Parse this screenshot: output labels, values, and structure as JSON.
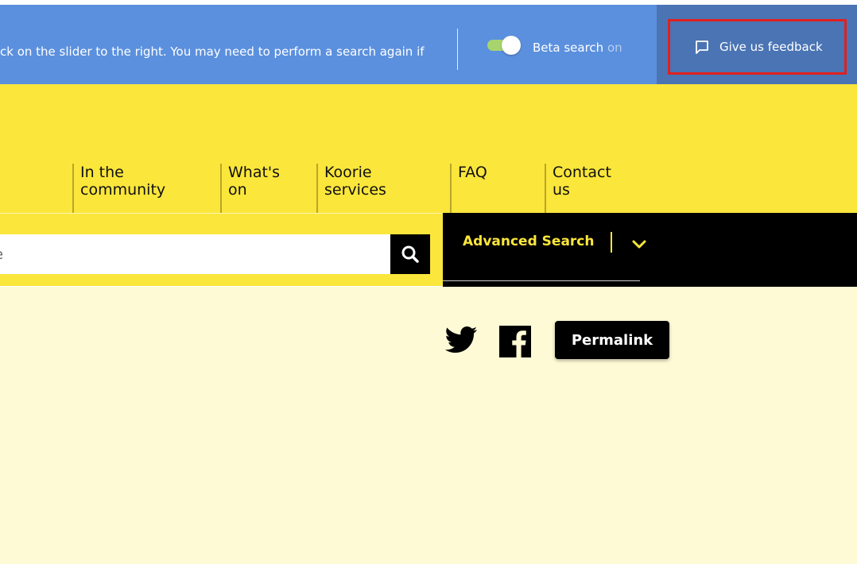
{
  "banner": {
    "message": "ck on the slider to the right. You may need to perform a search again if",
    "toggle_label": "Beta search",
    "toggle_state": "on",
    "feedback_label": "Give us feedback"
  },
  "nav": {
    "items": [
      {
        "line1": "In the",
        "line2": "community"
      },
      {
        "line1": "What's",
        "line2": "on"
      },
      {
        "line1": "Koorie",
        "line2": "services"
      },
      {
        "line1": "FAQ",
        "line2": ""
      },
      {
        "line1": "Contact",
        "line2": "us"
      }
    ]
  },
  "search": {
    "value": "re",
    "advanced_label": "Advanced Search"
  },
  "share": {
    "permalink_label": "Permalink"
  },
  "colors": {
    "banner_blue": "#5b90de",
    "feedback_blue": "#4a74b4",
    "brand_yellow": "#fbe63b",
    "content_cream": "#fefad5",
    "highlight_red": "#e0201e"
  }
}
